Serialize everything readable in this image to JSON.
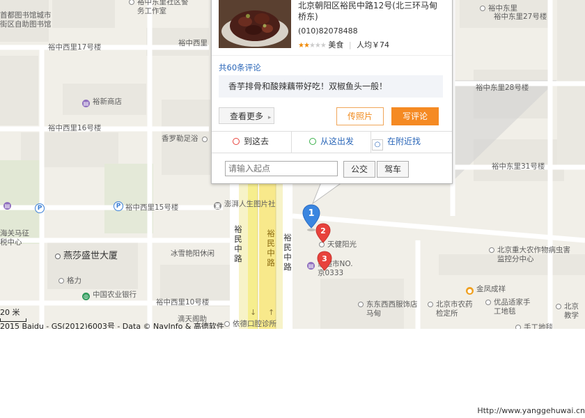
{
  "map": {
    "labels": {
      "police": "裕中东里社区警务工作室",
      "library": "首都图书馆城市街区自助图书馆",
      "xizhong17": "裕中西里17号楼",
      "xizhong_top": "裕中西里",
      "dongzhong": "裕中东里",
      "dong27": "裕中东里27号楼",
      "yuxin_shop": "裕新商店",
      "xizhong16": "裕中西里16号楼",
      "xiangluole": "香罗勒足浴",
      "dong28": "裕中东里28号楼",
      "dong31": "裕中东里31号楼",
      "xizhong15": "裕中西里15号楼",
      "pengpai": "澎湃人生图片社",
      "haiguan": "海关马征税中心",
      "yanshatower": "燕莎盛世大厦",
      "bingxue": "冰雪艳阳休闲",
      "geli": "格力",
      "abc_bank": "中国农业银行",
      "xizhong10": "裕中西里10号楼",
      "diding": "滴天阁助",
      "yide": "依德口腔诊所",
      "tianjian": "天健阳光",
      "supermarket": "家超市NO.京0333",
      "dongdong": "东东西西服饰店马甸",
      "jinfeng": "金凤成祥",
      "agri_med": "北京市农药检定所",
      "agri_univ": "北京重大农作物病虫害监控分中心",
      "youpin": "优品适家手工地毯",
      "beijing_edu": "北京教学",
      "shougong": "手工地毯",
      "road_yumin_main": "裕民中路",
      "road_yumin_left": "裕民中路",
      "road_yumin_right": "裕民中路",
      "scale": "20 米",
      "copyright": "2015 Baidu - GS(2012)6003号 - Data © NavInfo & 高德软件"
    },
    "markers": [
      "1",
      "2",
      "3"
    ]
  },
  "popup": {
    "address": "北京朝阳区裕民中路12号(北三环马甸桥东)",
    "phone": "(010)82078488",
    "rating_stars": 2,
    "rating_max": 5,
    "category": "美食",
    "avg_price": "人均￥74",
    "review_count": "共60条评论",
    "review_text": "香芋排骨和酸辣藕带好吃！双椒鱼头一般！",
    "more_label": "查看更多",
    "upload_photo_label": "传照片",
    "write_review_label": "写评论",
    "tabs": [
      "到这去",
      "从这出发",
      "在附近找"
    ],
    "start_placeholder": "请输入起点",
    "bus_label": "公交",
    "drive_label": "驾车"
  },
  "footer": {
    "url": "Http://www.yanggehuwai.cn"
  },
  "colors": {
    "accent_orange": "#f58a23",
    "link_blue": "#2a66b8",
    "marker_blue": "#3b86e0",
    "marker_red": "#e8423c"
  }
}
